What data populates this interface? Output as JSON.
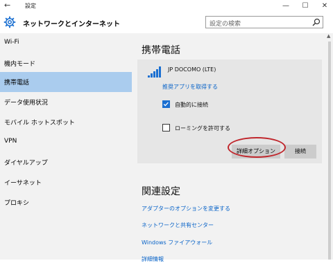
{
  "window": {
    "title": "設定",
    "back_icon": "back-arrow-icon",
    "controls": {
      "minimize": "—",
      "maximize": "☐",
      "close": "✕"
    }
  },
  "header": {
    "title": "ネットワークとインターネット",
    "icon": "gear-icon",
    "search_placeholder": "設定の検索"
  },
  "sidebar": {
    "items": [
      {
        "label": "Wi-Fi",
        "active": false
      },
      {
        "label": "機内モード",
        "active": false
      },
      {
        "label": "携帯電話",
        "active": true
      },
      {
        "label": "データ使用状況",
        "active": false
      },
      {
        "label": "モバイル ホットスポット",
        "active": false
      },
      {
        "label": "VPN",
        "active": false
      },
      {
        "label": "ダイヤルアップ",
        "active": false
      },
      {
        "label": "イーサネット",
        "active": false
      },
      {
        "label": "プロキシ",
        "active": false
      }
    ]
  },
  "main": {
    "section_title": "携帯電話",
    "network": {
      "carrier": "JP DOCOMO (LTE)",
      "app_link": "推奨アプリを取得する",
      "auto_connect": {
        "label": "自動的に接続",
        "checked": true
      },
      "roaming": {
        "label": "ローミングを許可する",
        "checked": false
      },
      "advanced_button": "詳細オプション",
      "connect_button": "接続"
    },
    "related": {
      "title": "関連設定",
      "links": [
        "アダプターのオプションを変更する",
        "ネットワークと共有センター",
        "Windows ファイアウォール",
        "詳細情報"
      ]
    }
  },
  "colors": {
    "accent": "#0a64c8",
    "selected_nav": "#aaccee",
    "checkbox": "#1a6fd1",
    "highlight_ellipse": "#c0262c"
  }
}
